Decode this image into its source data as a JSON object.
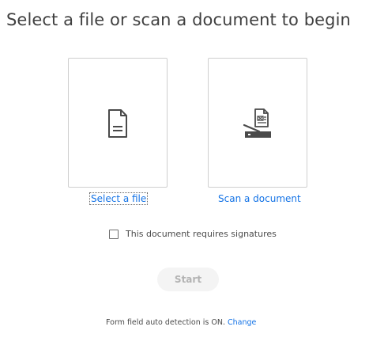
{
  "page": {
    "title": "Select a file or scan a document to begin"
  },
  "options": {
    "select_file_label": "Select a file",
    "scan_document_label": "Scan a document"
  },
  "signatures": {
    "label": "This document requires signatures",
    "checked": false
  },
  "start_button": {
    "label": "Start",
    "enabled": false
  },
  "footer": {
    "status_text": "Form field auto detection is ON.",
    "change_link": "Change"
  },
  "colors": {
    "link": "#1473e6",
    "border": "#cfcfcf",
    "disabled_button_bg": "#f4f4f4"
  }
}
